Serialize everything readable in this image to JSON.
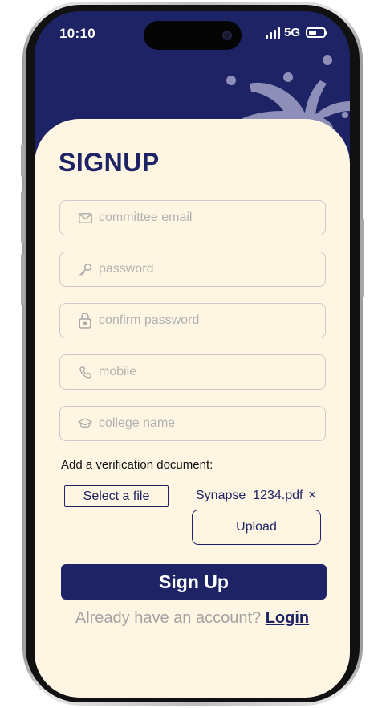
{
  "status_bar": {
    "time": "10:10",
    "network": "5G",
    "icons": [
      "signal-icon",
      "battery-icon"
    ]
  },
  "page": {
    "title": "SIGNUP"
  },
  "form": {
    "fields": [
      {
        "placeholder": "committee email",
        "value": "",
        "icon": "mail-icon"
      },
      {
        "placeholder": "password",
        "value": "",
        "icon": "key-icon"
      },
      {
        "placeholder": "confirm password",
        "value": "",
        "icon": "lock-icon"
      },
      {
        "placeholder": "mobile",
        "value": "",
        "icon": "phone-icon"
      },
      {
        "placeholder": "college name",
        "value": "",
        "icon": "graduation-cap-icon"
      }
    ],
    "document_label": "Add a verification document:",
    "select_file_label": "Select a file",
    "file_name": "Synapse_1234.pdf",
    "remove_symbol": "×",
    "upload_label": "Upload",
    "submit_label": "Sign Up",
    "login_prompt": "Already have an account?",
    "login_label": "Login"
  },
  "colors": {
    "primary": "#1e2366",
    "background": "#fef6e2",
    "decoration": "#8e8fb8",
    "placeholder": "#b2b2b2"
  }
}
